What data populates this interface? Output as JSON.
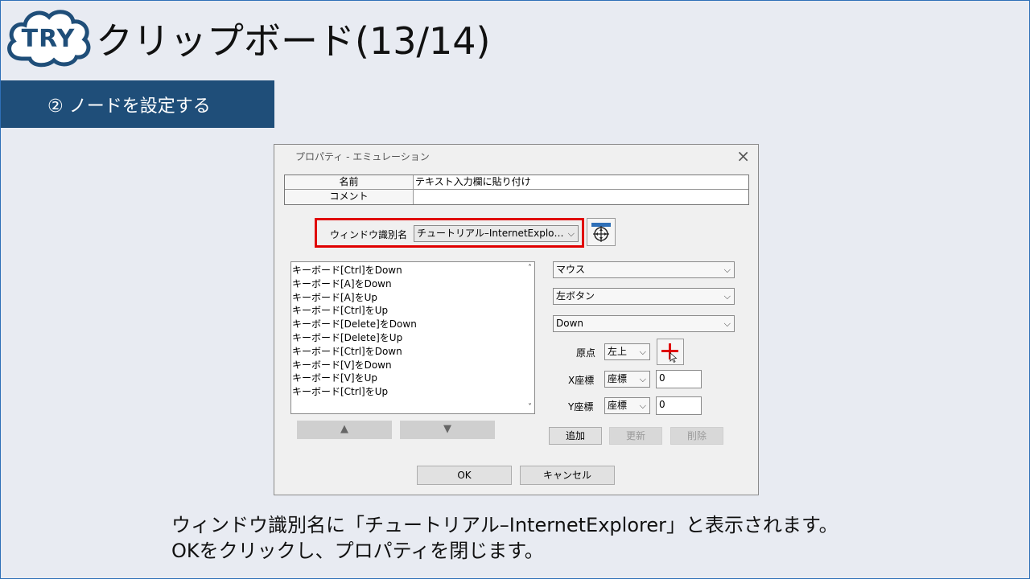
{
  "header": {
    "badge": "TRY",
    "title": "クリップボード(13/14)",
    "step": "② ノードを設定する"
  },
  "dialog": {
    "title": "プロパティ - エミュレーション",
    "close": "×",
    "props": [
      {
        "key": "名前",
        "value": "テキスト入力欄に貼り付け"
      },
      {
        "key": "コメント",
        "value": ""
      }
    ],
    "window_label": "ウィンドウ識別名",
    "window_value": "チュートリアル–InternetExplo…",
    "actions": [
      "キーボード[Ctrl]をDown",
      "キーボード[A]をDown",
      "キーボード[A]をUp",
      "キーボード[Ctrl]をUp",
      "キーボード[Delete]をDown",
      "キーボード[Delete]をUp",
      "キーボード[Ctrl]をDown",
      "キーボード[V]をDown",
      "キーボード[V]をUp",
      "キーボード[Ctrl]をUp"
    ],
    "move_up": "▲",
    "move_down": "▼",
    "device": "マウス",
    "button": "左ボタン",
    "event": "Down",
    "origin_label": "原点",
    "origin_value": "左上",
    "x_label": "X座標",
    "x_mode": "座標",
    "x_value": "0",
    "y_label": "Y座標",
    "y_mode": "座標",
    "y_value": "0",
    "add": "追加",
    "update": "更新",
    "delete": "削除",
    "ok": "OK",
    "cancel": "キャンセル"
  },
  "caption": {
    "line1": "ウィンドウ識別名に「チュートリアル–InternetExplorer」と表示されます。",
    "line2": "OKをクリックし、プロパティを閉じます。"
  },
  "colors": {
    "accent": "#1f4e79",
    "highlight": "#e00000",
    "background": "#e8ebf2"
  }
}
